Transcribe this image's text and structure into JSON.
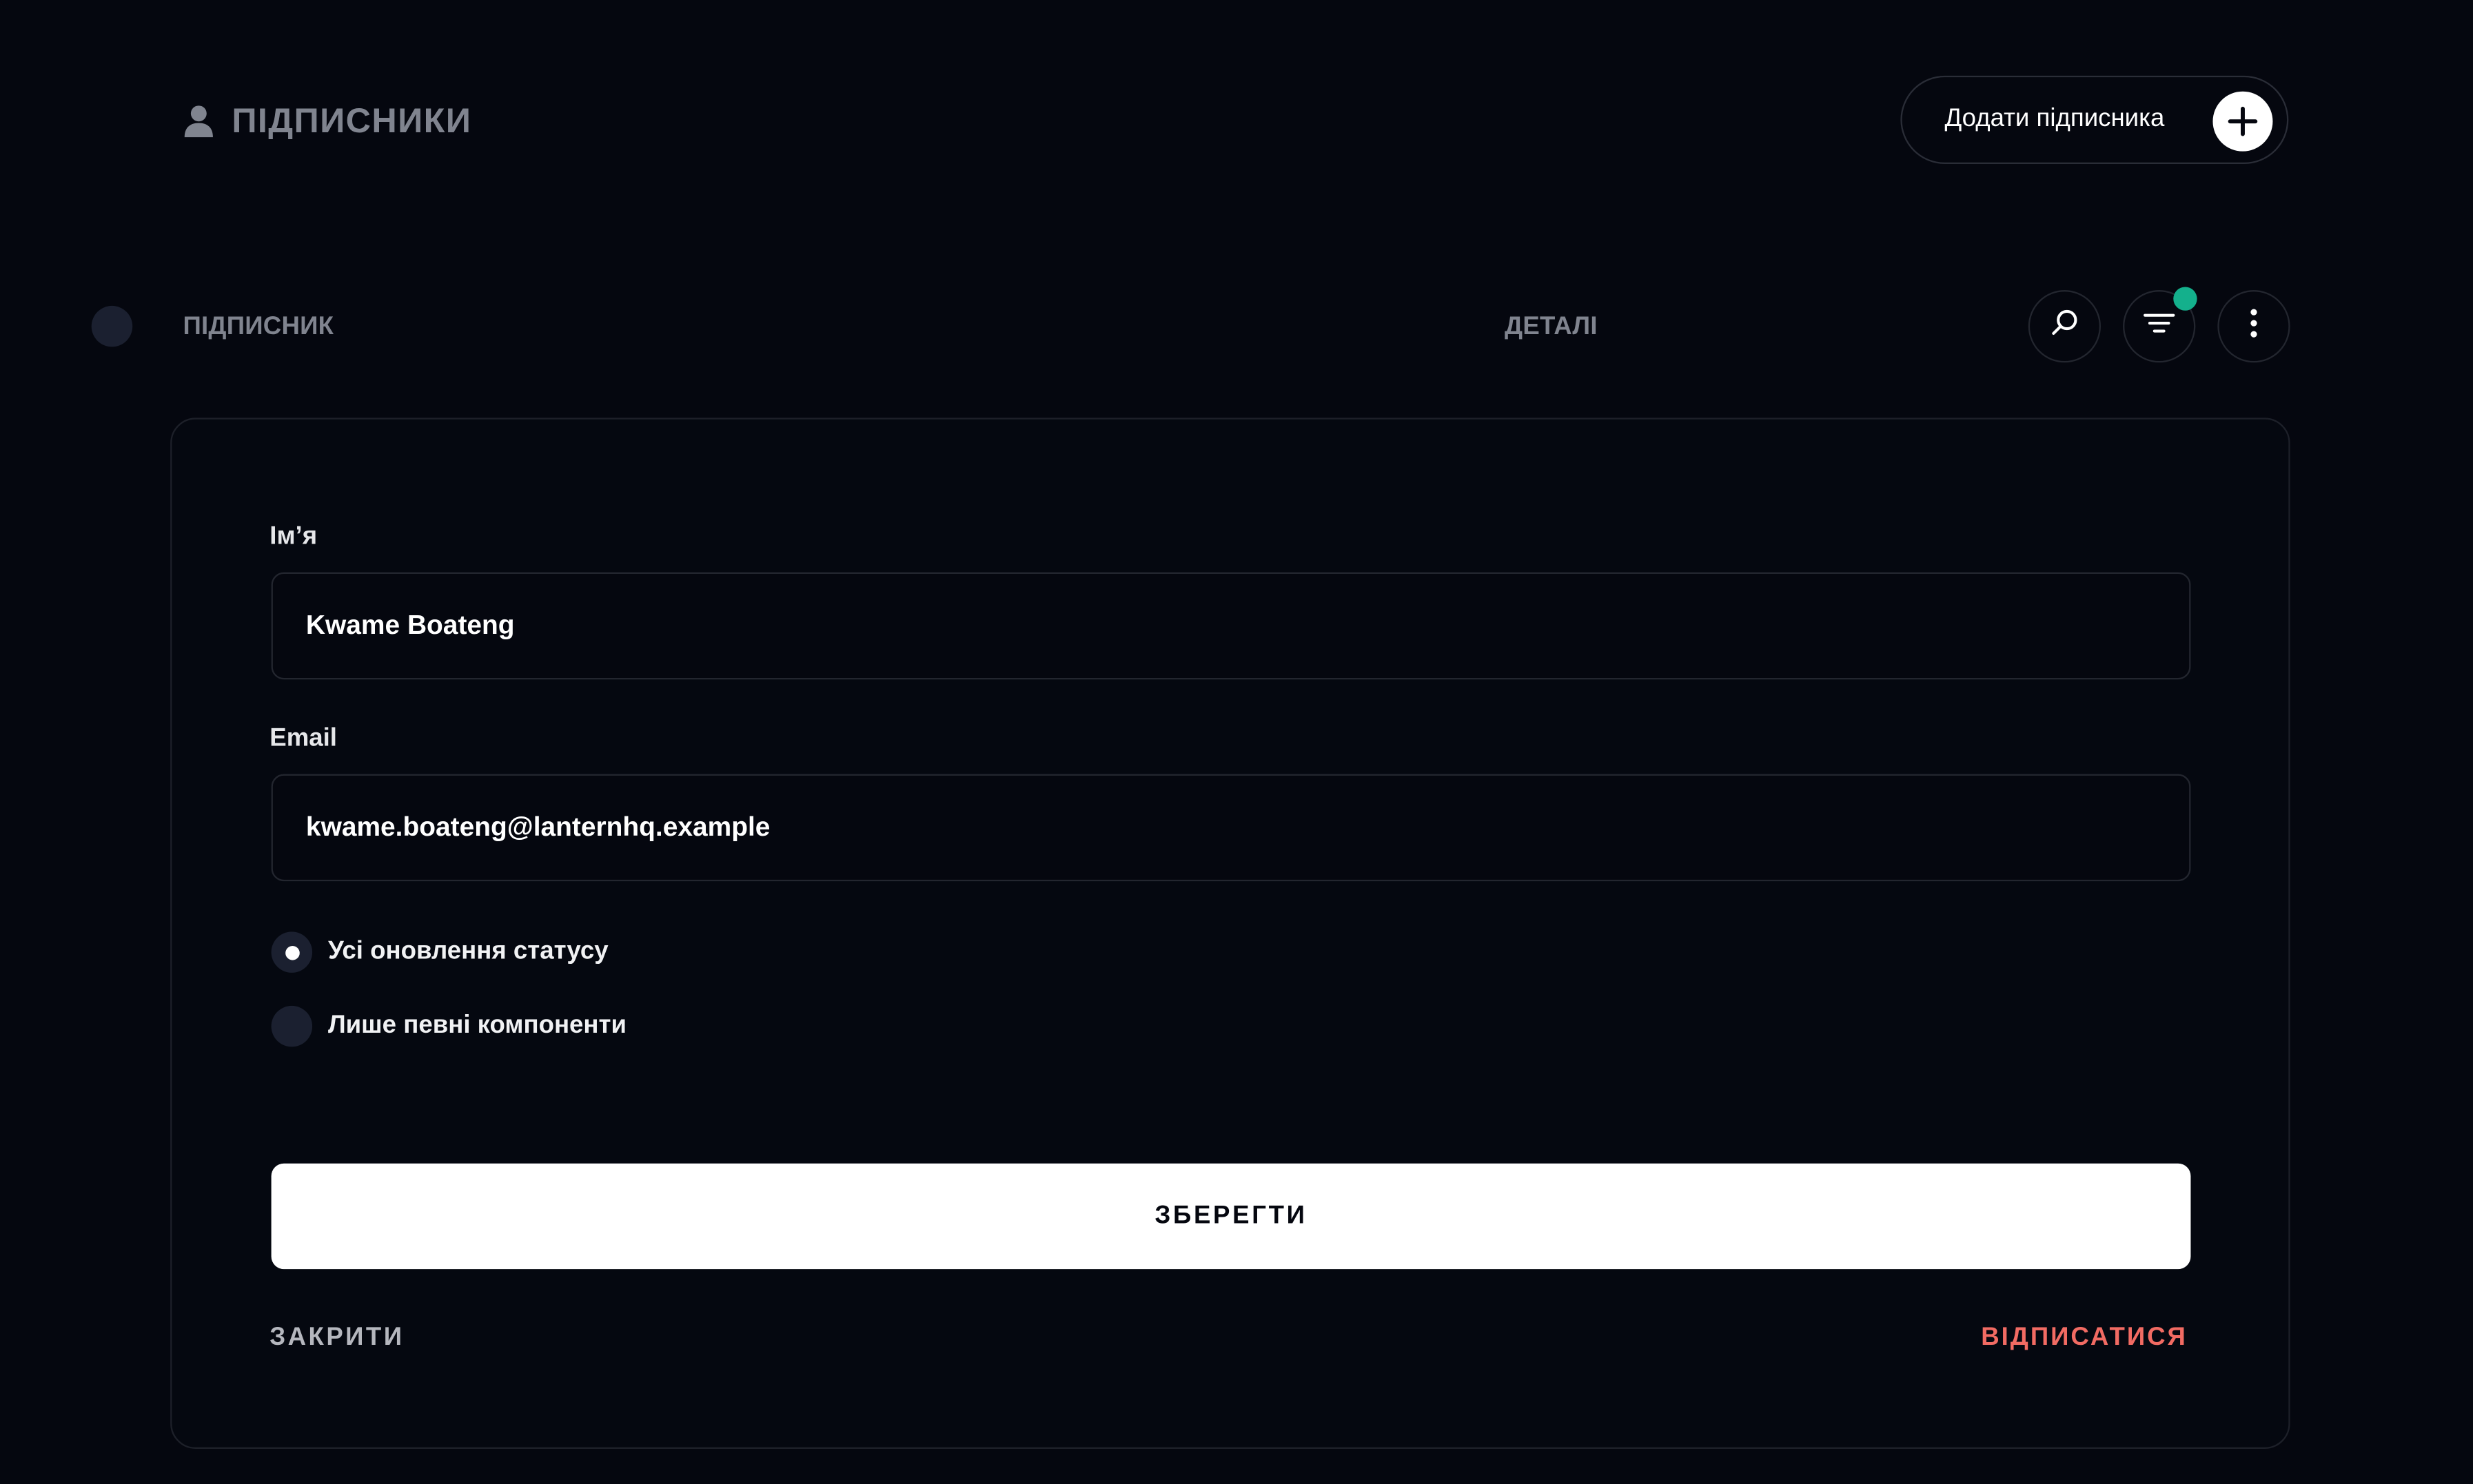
{
  "header": {
    "title": "ПІДПИСНИКИ",
    "add_button_label": "Додати підписника",
    "icon": "user-icon",
    "add_icon": "plus-icon"
  },
  "table_header": {
    "subscriber_col": "ПІДПИСНИК",
    "details_col": "ДЕТАЛІ",
    "actions": [
      "search-icon",
      "filter-icon",
      "more-vertical-icon"
    ],
    "filter_badge_color": "#14b08c"
  },
  "form": {
    "name_label": "Ім’я",
    "name_value": "Kwame Boateng",
    "email_label": "Email",
    "email_value": "kwame.boateng@lanternhq.example",
    "radio_options": [
      {
        "label": "Усі оновлення статусу",
        "selected": true
      },
      {
        "label": "Лише певні компоненти",
        "selected": false
      }
    ],
    "save_label": "ЗБЕРЕГТИ",
    "close_label": "ЗАКРИТИ",
    "unsubscribe_label": "ВІДПИСАТИСЯ"
  },
  "colors": {
    "background": "#05070f",
    "danger": "#f26b63",
    "muted_text": "#80848f"
  }
}
